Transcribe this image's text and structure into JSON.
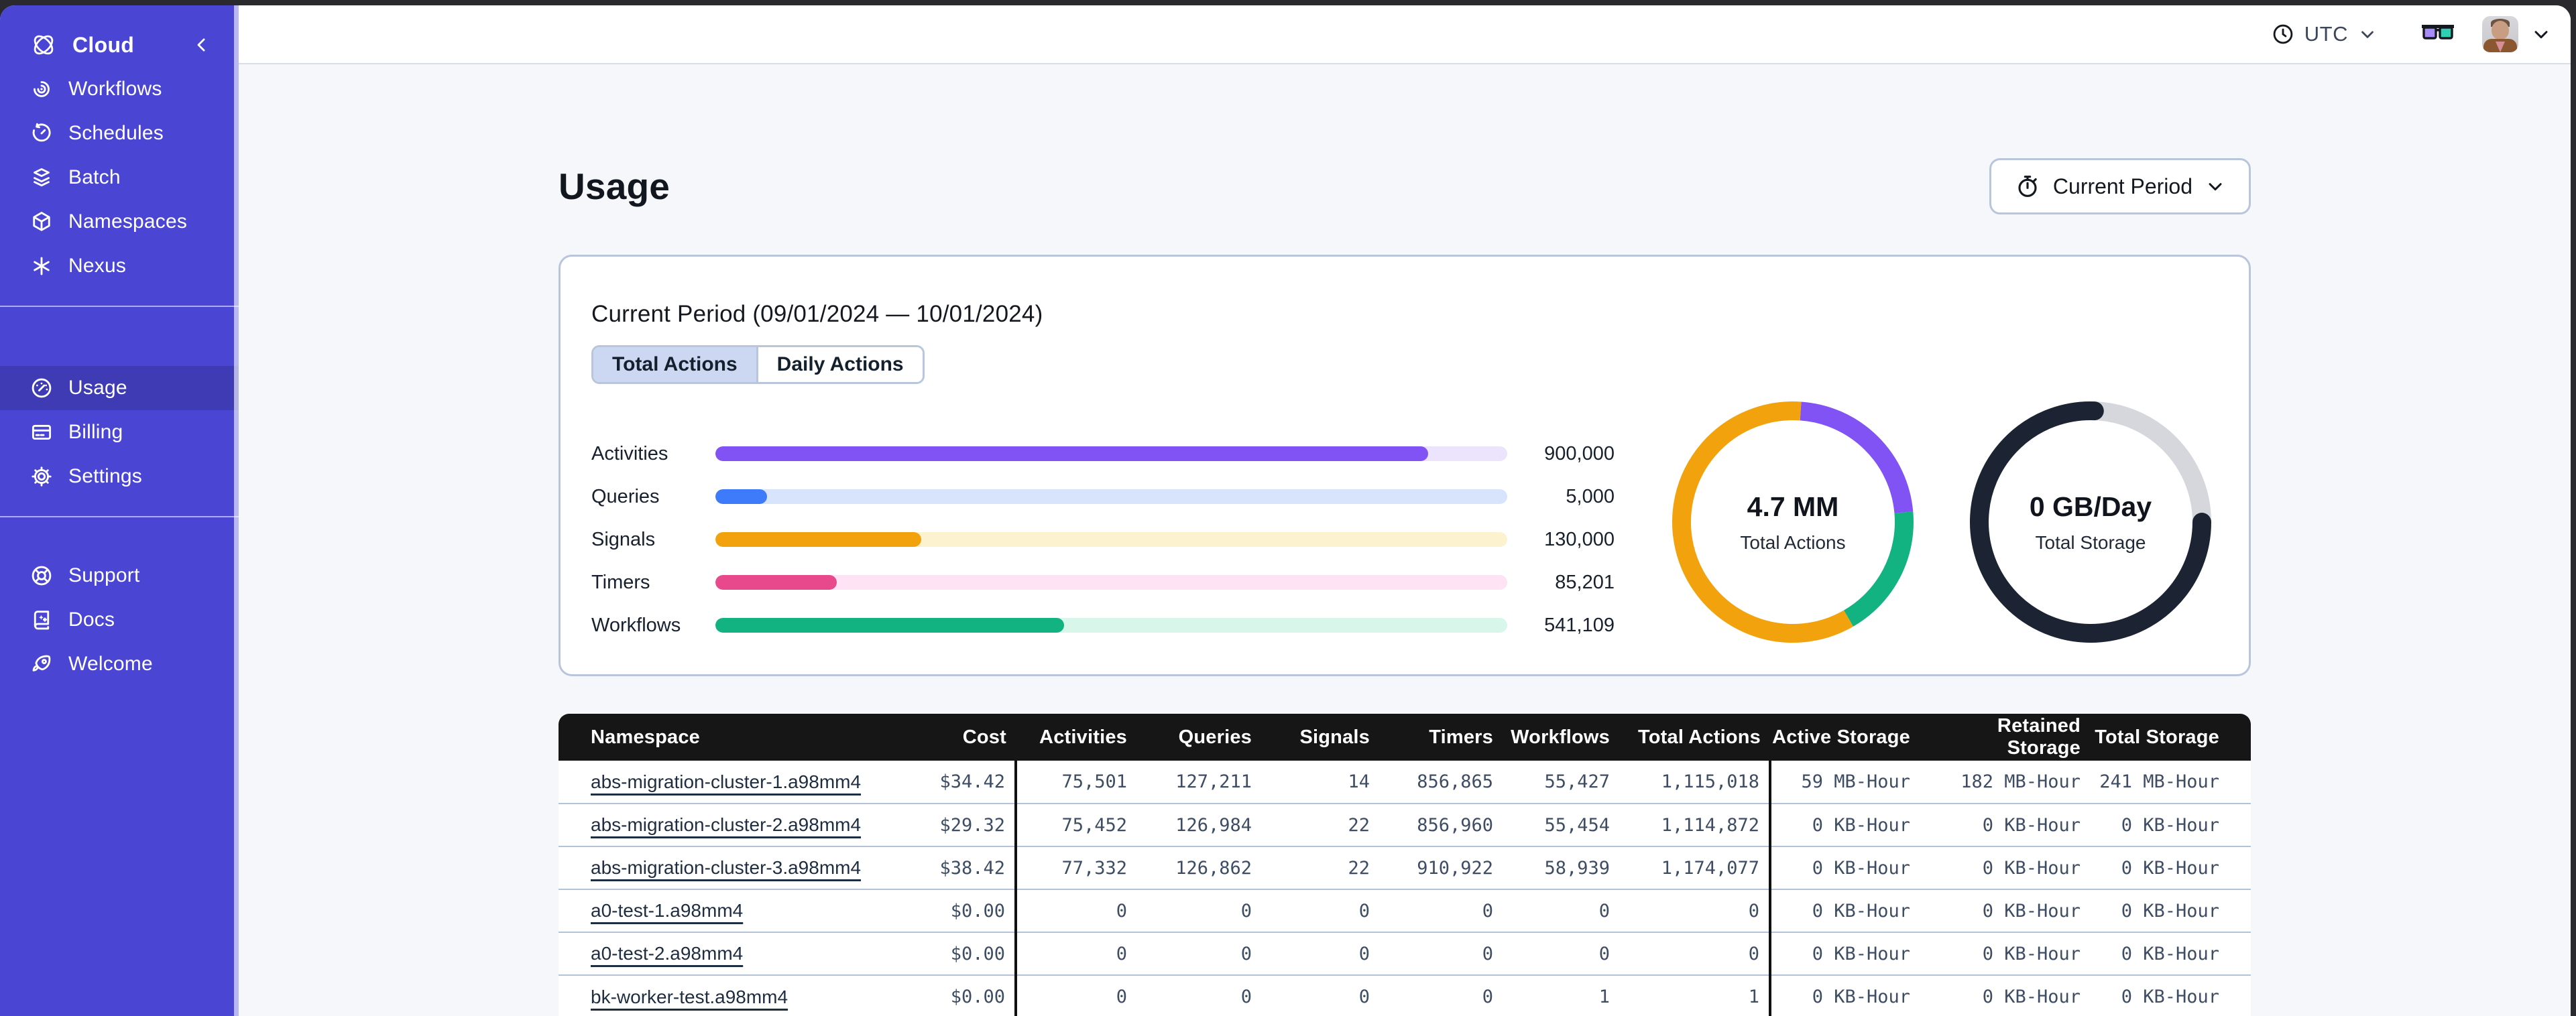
{
  "sidebar": {
    "brand": "Cloud",
    "sections": [
      {
        "items": [
          {
            "label": "Workflows",
            "icon": "workflows-icon"
          },
          {
            "label": "Schedules",
            "icon": "schedules-icon"
          },
          {
            "label": "Batch",
            "icon": "batch-icon"
          },
          {
            "label": "Namespaces",
            "icon": "namespaces-icon"
          },
          {
            "label": "Nexus",
            "icon": "nexus-icon"
          }
        ]
      },
      {
        "items": [
          {
            "label": "Usage",
            "icon": "usage-gauge-icon",
            "active": true
          },
          {
            "label": "Billing",
            "icon": "billing-card-icon"
          },
          {
            "label": "Settings",
            "icon": "settings-gear-icon"
          }
        ]
      },
      {
        "items": [
          {
            "label": "Support",
            "icon": "support-lifebuoy-icon"
          },
          {
            "label": "Docs",
            "icon": "docs-book-icon"
          },
          {
            "label": "Welcome",
            "icon": "welcome-rocket-icon"
          }
        ]
      }
    ]
  },
  "topbar": {
    "timezone": "UTC"
  },
  "page": {
    "title": "Usage",
    "period_selector": "Current Period"
  },
  "card": {
    "title": "Current Period (09/01/2024 — 10/01/2024)",
    "tabs": [
      "Total Actions",
      "Daily Actions"
    ],
    "active_tab": "Total Actions"
  },
  "chart_data": [
    {
      "type": "bar",
      "categories": [
        "Activities",
        "Queries",
        "Signals",
        "Timers",
        "Workflows"
      ],
      "values": [
        900000,
        5000,
        130000,
        85201,
        541109
      ],
      "value_labels": [
        "900,000",
        "5,000",
        "130,000",
        "85,201",
        "541,109"
      ],
      "fill_fractions": [
        0.9,
        0.065,
        0.26,
        0.153,
        0.44
      ],
      "bar_colors": [
        "#8152f4",
        "#3e7bfa",
        "#f2a20d",
        "#e8498d",
        "#12b380"
      ],
      "track_colors": [
        "#ece4fc",
        "#d7e4fb",
        "#fdf2d0",
        "#fde3f3",
        "#d9f6ea"
      ]
    },
    {
      "type": "donut",
      "center_value": "4.7 MM",
      "center_label": "Total Actions",
      "segments": [
        {
          "name": "activities",
          "color": "#8152f4",
          "start_deg": 4,
          "end_deg": 85
        },
        {
          "name": "workflows",
          "color": "#12b380",
          "start_deg": 85,
          "end_deg": 150
        },
        {
          "name": "signals",
          "color": "#f2a20d",
          "start_deg": 150,
          "end_deg": 364
        }
      ]
    },
    {
      "type": "donut",
      "center_value": "0 GB/Day",
      "center_label": "Total Storage",
      "track_color": "#d5d7dc",
      "segments": [
        {
          "name": "storage",
          "color": "#1c2433",
          "start_deg": 90,
          "end_deg": 362,
          "round_caps": true
        }
      ]
    }
  ],
  "table": {
    "columns": [
      "Namespace",
      "Cost",
      "Activities",
      "Queries",
      "Signals",
      "Timers",
      "Workflows",
      "Total Actions",
      "Active Storage",
      "Retained Storage",
      "Total Storage"
    ],
    "rows": [
      [
        "abs-migration-cluster-1.a98mm4",
        "$34.42",
        "75,501",
        "127,211",
        "14",
        "856,865",
        "55,427",
        "1,115,018",
        "59 MB-Hour",
        "182 MB-Hour",
        "241 MB-Hour"
      ],
      [
        "abs-migration-cluster-2.a98mm4",
        "$29.32",
        "75,452",
        "126,984",
        "22",
        "856,960",
        "55,454",
        "1,114,872",
        "0 KB-Hour",
        "0 KB-Hour",
        "0 KB-Hour"
      ],
      [
        "abs-migration-cluster-3.a98mm4",
        "$38.42",
        "77,332",
        "126,862",
        "22",
        "910,922",
        "58,939",
        "1,174,077",
        "0 KB-Hour",
        "0 KB-Hour",
        "0 KB-Hour"
      ],
      [
        "a0-test-1.a98mm4",
        "$0.00",
        "0",
        "0",
        "0",
        "0",
        "0",
        "0",
        "0 KB-Hour",
        "0 KB-Hour",
        "0 KB-Hour"
      ],
      [
        "a0-test-2.a98mm4",
        "$0.00",
        "0",
        "0",
        "0",
        "0",
        "0",
        "0",
        "0 KB-Hour",
        "0 KB-Hour",
        "0 KB-Hour"
      ],
      [
        "bk-worker-test.a98mm4",
        "$0.00",
        "0",
        "0",
        "0",
        "0",
        "1",
        "1",
        "0 KB-Hour",
        "0 KB-Hour",
        "0 KB-Hour"
      ]
    ]
  }
}
